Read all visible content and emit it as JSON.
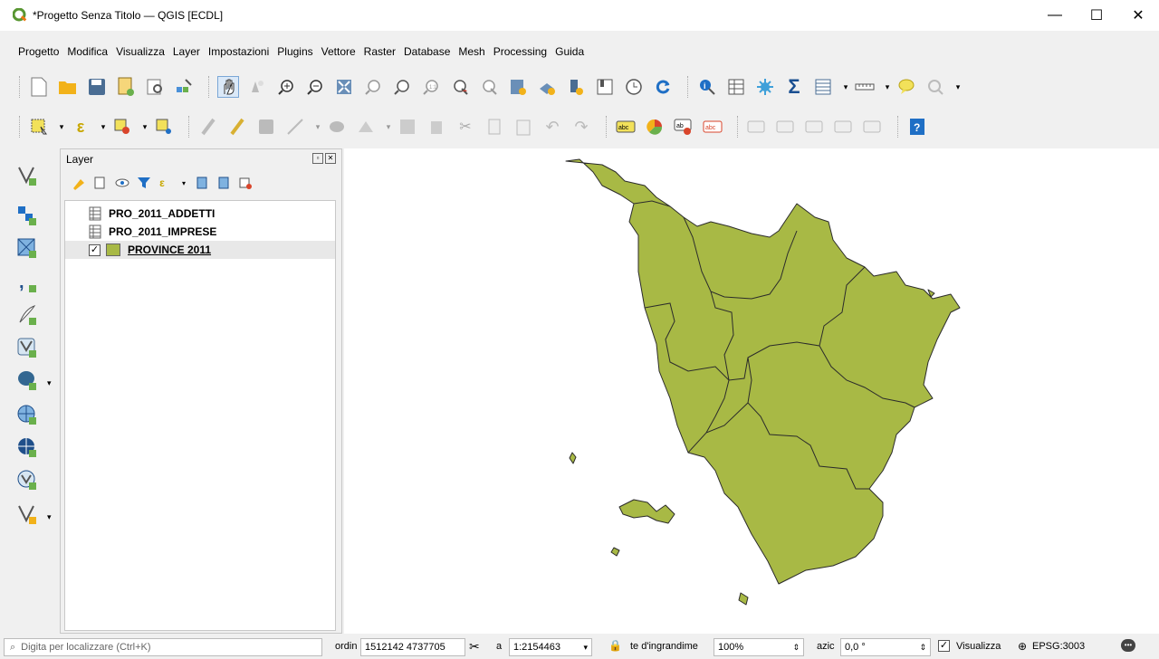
{
  "window": {
    "title": "*Progetto Senza Titolo — QGIS [ECDL]",
    "minimize": "—",
    "maximize": "☐",
    "close": "✕"
  },
  "menu": [
    "Progetto",
    "Modifica",
    "Visualizza",
    "Layer",
    "Impostazioni",
    "Plugins",
    "Vettore",
    "Raster",
    "Database",
    "Mesh",
    "Processing",
    "Guida"
  ],
  "layers_panel": {
    "title": "Layer",
    "layers": [
      {
        "name": "PRO_2011_ADDETTI",
        "type": "table",
        "checked": false
      },
      {
        "name": "PRO_2011_IMPRESE",
        "type": "table",
        "checked": false
      },
      {
        "name": "PROVINCE 2011",
        "type": "polygon",
        "checked": true,
        "color": "#a8b945"
      }
    ]
  },
  "map": {
    "fill": "#a8b945",
    "stroke": "#2b2b2b"
  },
  "statusbar": {
    "search_placeholder": "Digita per localizzare (Ctrl+K)",
    "coord_label": "ordin",
    "coord_value": "1512142 4737705",
    "scale_label": "a",
    "scale_value": "1:2154463",
    "magnifier_label": "te d'ingrandime",
    "magnifier_value": "100%",
    "rotation_label": "azic",
    "rotation_value": "0,0 °",
    "render_label": "Visualizza",
    "crs": "EPSG:3003"
  }
}
